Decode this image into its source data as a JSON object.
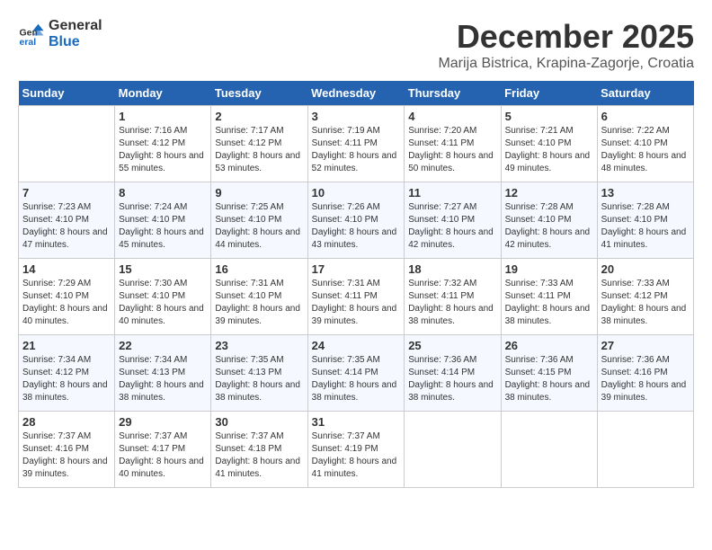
{
  "header": {
    "logo_general": "General",
    "logo_blue": "Blue",
    "month_title": "December 2025",
    "location": "Marija Bistrica, Krapina-Zagorje, Croatia"
  },
  "days_of_week": [
    "Sunday",
    "Monday",
    "Tuesday",
    "Wednesday",
    "Thursday",
    "Friday",
    "Saturday"
  ],
  "weeks": [
    [
      {
        "day": "",
        "empty": true
      },
      {
        "day": "1",
        "sunrise": "7:16 AM",
        "sunset": "4:12 PM",
        "daylight": "8 hours and 55 minutes."
      },
      {
        "day": "2",
        "sunrise": "7:17 AM",
        "sunset": "4:12 PM",
        "daylight": "8 hours and 53 minutes."
      },
      {
        "day": "3",
        "sunrise": "7:19 AM",
        "sunset": "4:11 PM",
        "daylight": "8 hours and 52 minutes."
      },
      {
        "day": "4",
        "sunrise": "7:20 AM",
        "sunset": "4:11 PM",
        "daylight": "8 hours and 50 minutes."
      },
      {
        "day": "5",
        "sunrise": "7:21 AM",
        "sunset": "4:10 PM",
        "daylight": "8 hours and 49 minutes."
      },
      {
        "day": "6",
        "sunrise": "7:22 AM",
        "sunset": "4:10 PM",
        "daylight": "8 hours and 48 minutes."
      }
    ],
    [
      {
        "day": "7",
        "sunrise": "7:23 AM",
        "sunset": "4:10 PM",
        "daylight": "8 hours and 47 minutes."
      },
      {
        "day": "8",
        "sunrise": "7:24 AM",
        "sunset": "4:10 PM",
        "daylight": "8 hours and 45 minutes."
      },
      {
        "day": "9",
        "sunrise": "7:25 AM",
        "sunset": "4:10 PM",
        "daylight": "8 hours and 44 minutes."
      },
      {
        "day": "10",
        "sunrise": "7:26 AM",
        "sunset": "4:10 PM",
        "daylight": "8 hours and 43 minutes."
      },
      {
        "day": "11",
        "sunrise": "7:27 AM",
        "sunset": "4:10 PM",
        "daylight": "8 hours and 42 minutes."
      },
      {
        "day": "12",
        "sunrise": "7:28 AM",
        "sunset": "4:10 PM",
        "daylight": "8 hours and 42 minutes."
      },
      {
        "day": "13",
        "sunrise": "7:28 AM",
        "sunset": "4:10 PM",
        "daylight": "8 hours and 41 minutes."
      }
    ],
    [
      {
        "day": "14",
        "sunrise": "7:29 AM",
        "sunset": "4:10 PM",
        "daylight": "8 hours and 40 minutes."
      },
      {
        "day": "15",
        "sunrise": "7:30 AM",
        "sunset": "4:10 PM",
        "daylight": "8 hours and 40 minutes."
      },
      {
        "day": "16",
        "sunrise": "7:31 AM",
        "sunset": "4:10 PM",
        "daylight": "8 hours and 39 minutes."
      },
      {
        "day": "17",
        "sunrise": "7:31 AM",
        "sunset": "4:11 PM",
        "daylight": "8 hours and 39 minutes."
      },
      {
        "day": "18",
        "sunrise": "7:32 AM",
        "sunset": "4:11 PM",
        "daylight": "8 hours and 38 minutes."
      },
      {
        "day": "19",
        "sunrise": "7:33 AM",
        "sunset": "4:11 PM",
        "daylight": "8 hours and 38 minutes."
      },
      {
        "day": "20",
        "sunrise": "7:33 AM",
        "sunset": "4:12 PM",
        "daylight": "8 hours and 38 minutes."
      }
    ],
    [
      {
        "day": "21",
        "sunrise": "7:34 AM",
        "sunset": "4:12 PM",
        "daylight": "8 hours and 38 minutes."
      },
      {
        "day": "22",
        "sunrise": "7:34 AM",
        "sunset": "4:13 PM",
        "daylight": "8 hours and 38 minutes."
      },
      {
        "day": "23",
        "sunrise": "7:35 AM",
        "sunset": "4:13 PM",
        "daylight": "8 hours and 38 minutes."
      },
      {
        "day": "24",
        "sunrise": "7:35 AM",
        "sunset": "4:14 PM",
        "daylight": "8 hours and 38 minutes."
      },
      {
        "day": "25",
        "sunrise": "7:36 AM",
        "sunset": "4:14 PM",
        "daylight": "8 hours and 38 minutes."
      },
      {
        "day": "26",
        "sunrise": "7:36 AM",
        "sunset": "4:15 PM",
        "daylight": "8 hours and 38 minutes."
      },
      {
        "day": "27",
        "sunrise": "7:36 AM",
        "sunset": "4:16 PM",
        "daylight": "8 hours and 39 minutes."
      }
    ],
    [
      {
        "day": "28",
        "sunrise": "7:37 AM",
        "sunset": "4:16 PM",
        "daylight": "8 hours and 39 minutes."
      },
      {
        "day": "29",
        "sunrise": "7:37 AM",
        "sunset": "4:17 PM",
        "daylight": "8 hours and 40 minutes."
      },
      {
        "day": "30",
        "sunrise": "7:37 AM",
        "sunset": "4:18 PM",
        "daylight": "8 hours and 41 minutes."
      },
      {
        "day": "31",
        "sunrise": "7:37 AM",
        "sunset": "4:19 PM",
        "daylight": "8 hours and 41 minutes."
      },
      {
        "day": "",
        "empty": true
      },
      {
        "day": "",
        "empty": true
      },
      {
        "day": "",
        "empty": true
      }
    ]
  ]
}
